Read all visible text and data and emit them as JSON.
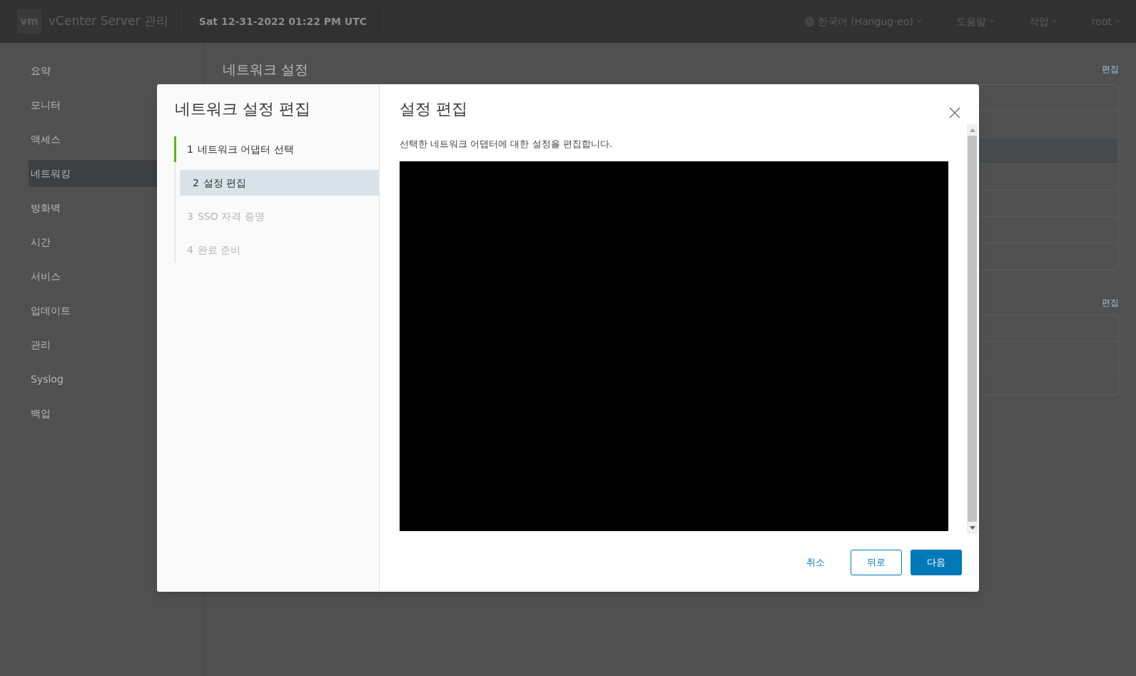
{
  "header": {
    "logo": "vm",
    "title": "vCenter Server 관리",
    "datetime": "Sat 12-31-2022 01:22 PM UTC",
    "menus": [
      {
        "label": "한국어 (Hangug-eo)",
        "kind": "language"
      },
      {
        "label": "도움말",
        "kind": "menu"
      },
      {
        "label": "작업",
        "kind": "menu"
      },
      {
        "label": "root",
        "kind": "menu"
      }
    ]
  },
  "sidebar": {
    "items": [
      {
        "label": "요약",
        "selected": false
      },
      {
        "label": "모니터",
        "selected": false
      },
      {
        "label": "액세스",
        "selected": false
      },
      {
        "label": "네트워킹",
        "selected": true
      },
      {
        "label": "방화벽",
        "selected": false
      },
      {
        "label": "시간",
        "selected": false
      },
      {
        "label": "서비스",
        "selected": false
      },
      {
        "label": "업데이트",
        "selected": false
      },
      {
        "label": "관리",
        "selected": false
      },
      {
        "label": "Syslog",
        "selected": false
      },
      {
        "label": "백업",
        "selected": false
      }
    ]
  },
  "main": {
    "title": "네트워크 설정",
    "sections": [
      {
        "action": "편집"
      },
      {
        "action": "편집"
      }
    ]
  },
  "dialog": {
    "title": "네트워크 설정 편집",
    "steps": [
      {
        "number": "1",
        "label": "네트워크 어댑터 선택",
        "completed": true,
        "selected": false,
        "disabled": false
      },
      {
        "number": "2",
        "label": "설정 편집",
        "completed": false,
        "selected": true,
        "disabled": false
      },
      {
        "number": "3",
        "label": "SSO 자격 증명",
        "completed": false,
        "selected": false,
        "disabled": true
      },
      {
        "number": "4",
        "label": "완료 준비",
        "completed": false,
        "selected": false,
        "disabled": true
      }
    ],
    "page_title": "설정 편집",
    "description": "선택한 네트워크 어댑터에 대한 설정을 편집합니다.",
    "buttons": [
      {
        "label": "취소",
        "kind": "flat"
      },
      {
        "label": "뒤로",
        "kind": "outline"
      },
      {
        "label": "다음",
        "kind": "primary"
      }
    ]
  }
}
